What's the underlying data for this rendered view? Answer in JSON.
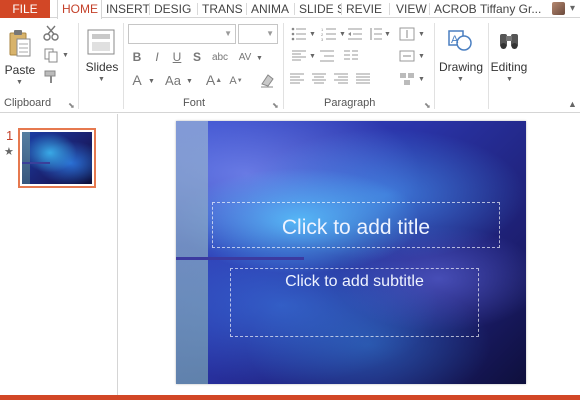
{
  "tabs": {
    "file": "FILE",
    "home": "HOME",
    "insert": "INSERT",
    "design": "DESIG",
    "transitions": "TRANS",
    "animations": "ANIMA",
    "slideshow": "SLIDE S",
    "review": "REVIE",
    "view": "VIEW",
    "acrobat": "ACROB"
  },
  "user": {
    "name": "Tiffany Gr..."
  },
  "ribbon": {
    "clipboard": {
      "paste": "Paste",
      "group": "Clipboard"
    },
    "slides": {
      "label": "Slides"
    },
    "font": {
      "group": "Font",
      "bold": "B",
      "italic": "I",
      "underline": "U",
      "strike": "S",
      "grow": "A",
      "change_case": "Aa"
    },
    "paragraph": {
      "group": "Paragraph"
    },
    "drawing": {
      "label": "Drawing"
    },
    "editing": {
      "label": "Editing"
    }
  },
  "thumbnails": [
    {
      "number": "1",
      "star": "★"
    }
  ],
  "slide": {
    "title_placeholder": "Click to add title",
    "subtitle_placeholder": "Click to add subtitle"
  },
  "colors": {
    "accent": "#d24726",
    "active_tab_text": "#c4412a"
  },
  "icons": [
    "cut-icon",
    "copy-icon",
    "format-painter-icon",
    "paste-icon",
    "new-slide-icon",
    "drawing-icon",
    "editing-icon"
  ]
}
